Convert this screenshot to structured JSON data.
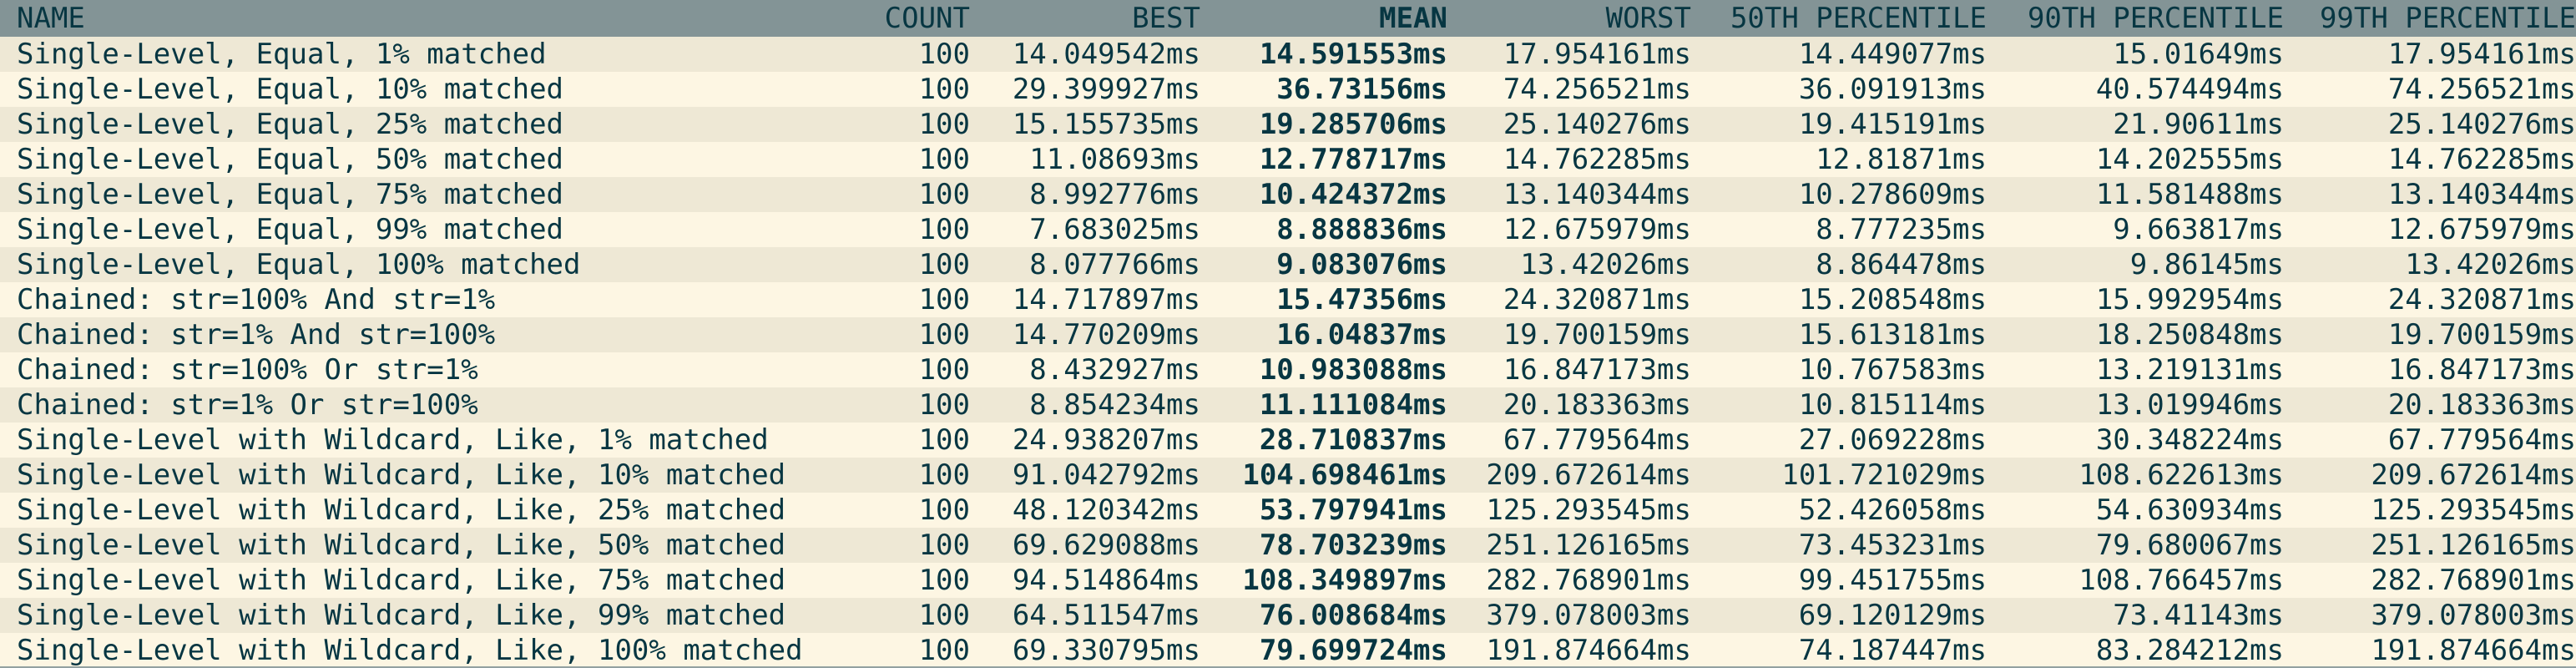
{
  "columns": [
    "NAME",
    "COUNT",
    "BEST",
    "MEAN",
    "WORST",
    "50TH PERCENTILE",
    "90TH PERCENTILE",
    "99TH PERCENTILE"
  ],
  "rows": [
    [
      "Single-Level, Equal, 1% matched",
      "100",
      "14.049542ms",
      "14.591553ms",
      "17.954161ms",
      "14.449077ms",
      "15.01649ms",
      "17.954161ms"
    ],
    [
      "Single-Level, Equal, 10% matched",
      "100",
      "29.399927ms",
      "36.73156ms",
      "74.256521ms",
      "36.091913ms",
      "40.574494ms",
      "74.256521ms"
    ],
    [
      "Single-Level, Equal, 25% matched",
      "100",
      "15.155735ms",
      "19.285706ms",
      "25.140276ms",
      "19.415191ms",
      "21.90611ms",
      "25.140276ms"
    ],
    [
      "Single-Level, Equal, 50% matched",
      "100",
      "11.08693ms",
      "12.778717ms",
      "14.762285ms",
      "12.81871ms",
      "14.202555ms",
      "14.762285ms"
    ],
    [
      "Single-Level, Equal, 75% matched",
      "100",
      "8.992776ms",
      "10.424372ms",
      "13.140344ms",
      "10.278609ms",
      "11.581488ms",
      "13.140344ms"
    ],
    [
      "Single-Level, Equal, 99% matched",
      "100",
      "7.683025ms",
      "8.888836ms",
      "12.675979ms",
      "8.777235ms",
      "9.663817ms",
      "12.675979ms"
    ],
    [
      "Single-Level, Equal, 100% matched",
      "100",
      "8.077766ms",
      "9.083076ms",
      "13.42026ms",
      "8.864478ms",
      "9.86145ms",
      "13.42026ms"
    ],
    [
      "Chained: str=100% And str=1%",
      "100",
      "14.717897ms",
      "15.47356ms",
      "24.320871ms",
      "15.208548ms",
      "15.992954ms",
      "24.320871ms"
    ],
    [
      "Chained: str=1% And str=100%",
      "100",
      "14.770209ms",
      "16.04837ms",
      "19.700159ms",
      "15.613181ms",
      "18.250848ms",
      "19.700159ms"
    ],
    [
      "Chained: str=100% Or str=1%",
      "100",
      "8.432927ms",
      "10.983088ms",
      "16.847173ms",
      "10.767583ms",
      "13.219131ms",
      "16.847173ms"
    ],
    [
      "Chained: str=1% Or str=100%",
      "100",
      "8.854234ms",
      "11.111084ms",
      "20.183363ms",
      "10.815114ms",
      "13.019946ms",
      "20.183363ms"
    ],
    [
      "Single-Level with Wildcard, Like, 1% matched",
      "100",
      "24.938207ms",
      "28.710837ms",
      "67.779564ms",
      "27.069228ms",
      "30.348224ms",
      "67.779564ms"
    ],
    [
      "Single-Level with Wildcard, Like, 10% matched",
      "100",
      "91.042792ms",
      "104.698461ms",
      "209.672614ms",
      "101.721029ms",
      "108.622613ms",
      "209.672614ms"
    ],
    [
      "Single-Level with Wildcard, Like, 25% matched",
      "100",
      "48.120342ms",
      "53.797941ms",
      "125.293545ms",
      "52.426058ms",
      "54.630934ms",
      "125.293545ms"
    ],
    [
      "Single-Level with Wildcard, Like, 50% matched",
      "100",
      "69.629088ms",
      "78.703239ms",
      "251.126165ms",
      "73.453231ms",
      "79.680067ms",
      "251.126165ms"
    ],
    [
      "Single-Level with Wildcard, Like, 75% matched",
      "100",
      "94.514864ms",
      "108.349897ms",
      "282.768901ms",
      "99.451755ms",
      "108.766457ms",
      "282.768901ms"
    ],
    [
      "Single-Level with Wildcard, Like, 99% matched",
      "100",
      "64.511547ms",
      "76.008684ms",
      "379.078003ms",
      "69.120129ms",
      "73.41143ms",
      "379.078003ms"
    ],
    [
      "Single-Level with Wildcard, Like, 100% matched",
      "100",
      "69.330795ms",
      "79.699724ms",
      "191.874664ms",
      "74.187447ms",
      "83.284212ms",
      "191.874664ms"
    ]
  ],
  "colors": {
    "header_bg": "#839496",
    "row_bg": "#fdf6e3",
    "row_alt_bg": "#eee8d5",
    "text": "#073642"
  }
}
